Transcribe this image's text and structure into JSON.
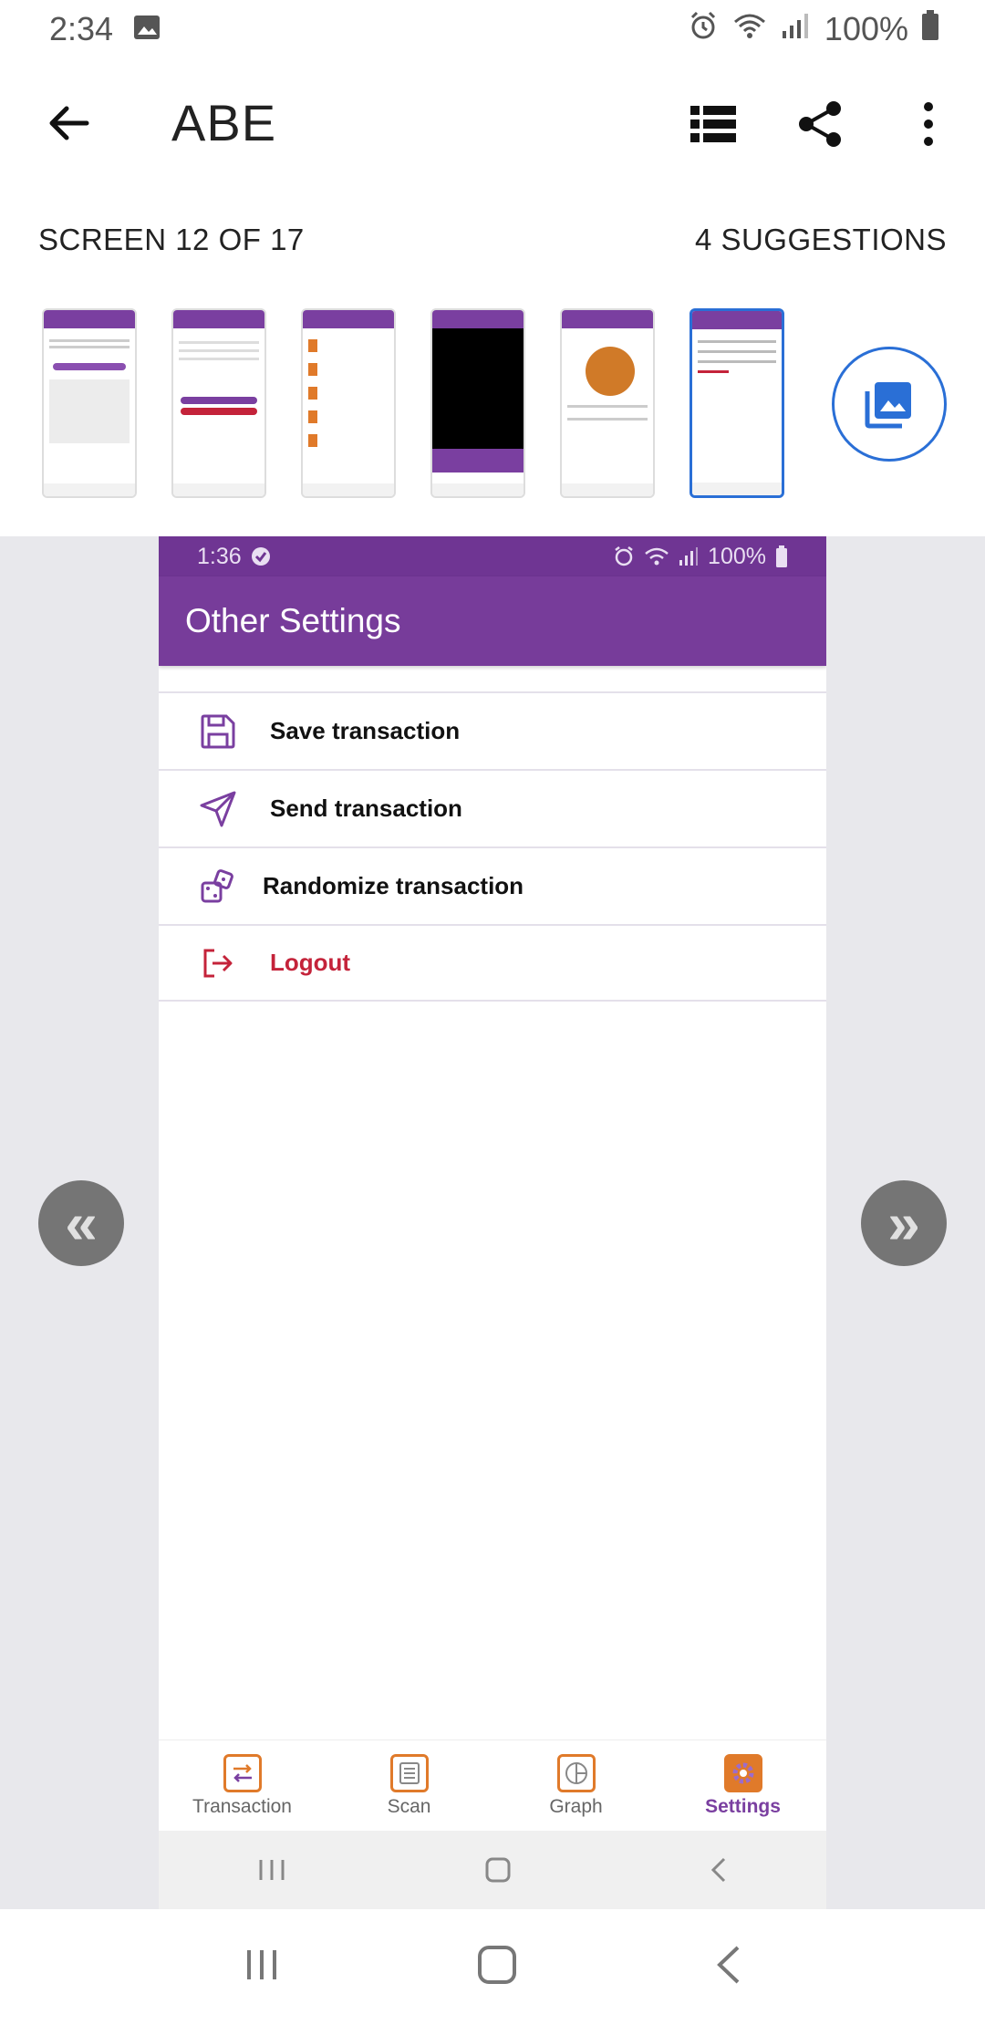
{
  "status_bar": {
    "time": "2:34",
    "battery": "100%",
    "icons": [
      "image-icon",
      "alarm-icon",
      "wifi-icon",
      "signal-icon",
      "battery-icon"
    ]
  },
  "app_bar": {
    "title": "ABE",
    "actions": [
      "list-icon",
      "share-icon",
      "more-vert-icon"
    ]
  },
  "screen_info": {
    "position": "SCREEN 12 OF 17",
    "suggestions": "4 SUGGESTIONS"
  },
  "thumbnails": {
    "selected_index": 5,
    "count": 6
  },
  "phone": {
    "status": {
      "time": "1:36",
      "battery": "100%"
    },
    "title": "Other Settings",
    "menu": [
      {
        "label": "Save transaction",
        "icon": "save-icon"
      },
      {
        "label": "Send transaction",
        "icon": "send-icon"
      },
      {
        "label": "Randomize transaction",
        "icon": "dice-icon"
      },
      {
        "label": "Logout",
        "icon": "logout-icon"
      }
    ],
    "bottom_nav": [
      {
        "label": "Transaction",
        "icon": "transaction-icon"
      },
      {
        "label": "Scan",
        "icon": "scan-icon"
      },
      {
        "label": "Graph",
        "icon": "graph-icon"
      },
      {
        "label": "Settings",
        "icon": "settings-icon",
        "active": true
      }
    ]
  },
  "nav": {
    "prev": "«",
    "next": "»"
  },
  "colors": {
    "purple": "#773c9a",
    "accent_blue": "#2a6fd6",
    "orange": "#e07a2a",
    "logout_red": "#c4233a"
  }
}
